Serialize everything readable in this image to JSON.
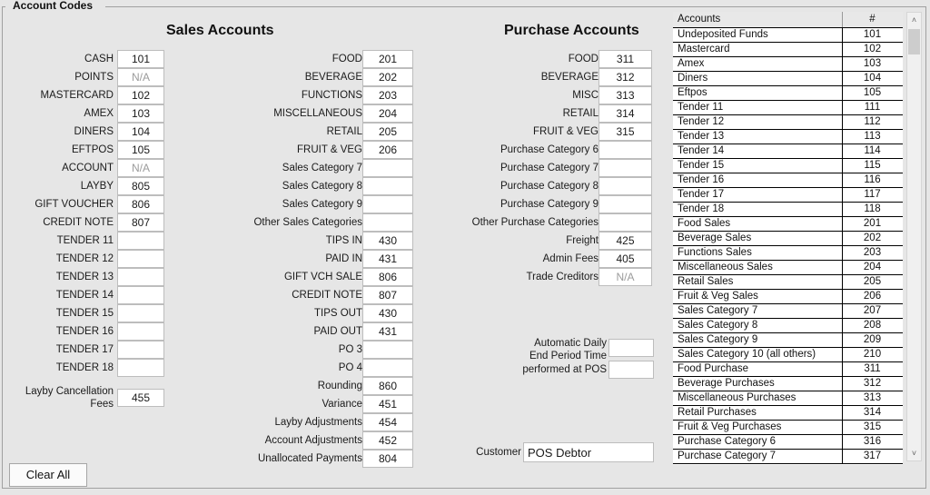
{
  "groupbox": {
    "title": "Account Codes"
  },
  "columns": {
    "sales": {
      "title": "Sales Accounts"
    },
    "purchase": {
      "title": "Purchase Accounts"
    }
  },
  "buttons": {
    "clear_all": "Clear All"
  },
  "left_column": {
    "rows": [
      {
        "label": "CASH",
        "value": "101",
        "disabled": false
      },
      {
        "label": "POINTS",
        "value": "N/A",
        "disabled": true
      },
      {
        "label": "MASTERCARD",
        "value": "102",
        "disabled": false
      },
      {
        "label": "AMEX",
        "value": "103",
        "disabled": false
      },
      {
        "label": "DINERS",
        "value": "104",
        "disabled": false
      },
      {
        "label": "EFTPOS",
        "value": "105",
        "disabled": false
      },
      {
        "label": "ACCOUNT",
        "value": "N/A",
        "disabled": true
      },
      {
        "label": "LAYBY",
        "value": "805",
        "disabled": false
      },
      {
        "label": "GIFT VOUCHER",
        "value": "806",
        "disabled": false
      },
      {
        "label": "CREDIT NOTE",
        "value": "807",
        "disabled": false
      },
      {
        "label": "TENDER 11",
        "value": "",
        "disabled": false
      },
      {
        "label": "TENDER 12",
        "value": "",
        "disabled": false
      },
      {
        "label": "TENDER 13",
        "value": "",
        "disabled": false
      },
      {
        "label": "TENDER 14",
        "value": "",
        "disabled": false
      },
      {
        "label": "TENDER 15",
        "value": "",
        "disabled": false
      },
      {
        "label": "TENDER 16",
        "value": "",
        "disabled": false
      },
      {
        "label": "TENDER 17",
        "value": "",
        "disabled": false
      },
      {
        "label": "TENDER 18",
        "value": "",
        "disabled": false
      }
    ],
    "layby_fee": {
      "label_line1": "Layby Cancellation",
      "label_line2": "Fees",
      "value": "455"
    }
  },
  "middle_column": {
    "rows": [
      {
        "label": "FOOD",
        "value": "201"
      },
      {
        "label": "BEVERAGE",
        "value": "202"
      },
      {
        "label": "FUNCTIONS",
        "value": "203"
      },
      {
        "label": "MISCELLANEOUS",
        "value": "204"
      },
      {
        "label": "RETAIL",
        "value": "205"
      },
      {
        "label": "FRUIT & VEG",
        "value": "206"
      },
      {
        "label": "Sales Category 7",
        "value": ""
      },
      {
        "label": "Sales Category 8",
        "value": ""
      },
      {
        "label": "Sales Category 9",
        "value": ""
      },
      {
        "label": "Other Sales Categories",
        "value": ""
      },
      {
        "label": "TIPS IN",
        "value": "430"
      },
      {
        "label": "PAID IN",
        "value": "431"
      },
      {
        "label": "GIFT VCH SALE",
        "value": "806"
      },
      {
        "label": "CREDIT NOTE",
        "value": "807"
      },
      {
        "label": "TIPS OUT",
        "value": "430"
      },
      {
        "label": "PAID OUT",
        "value": "431"
      },
      {
        "label": "PO 3",
        "value": ""
      },
      {
        "label": "PO 4",
        "value": ""
      },
      {
        "label": "Rounding",
        "value": "860"
      },
      {
        "label": "Variance",
        "value": "451"
      },
      {
        "label": "Layby Adjustments",
        "value": "454"
      },
      {
        "label": "Account Adjustments",
        "value": "452"
      },
      {
        "label": "Unallocated Payments",
        "value": "804"
      }
    ]
  },
  "right_column": {
    "rows": [
      {
        "label": "FOOD",
        "value": "311",
        "disabled": false
      },
      {
        "label": "BEVERAGE",
        "value": "312",
        "disabled": false
      },
      {
        "label": "MISC",
        "value": "313",
        "disabled": false
      },
      {
        "label": "RETAIL",
        "value": "314",
        "disabled": false
      },
      {
        "label": "FRUIT & VEG",
        "value": "315",
        "disabled": false
      },
      {
        "label": "Purchase Category 6",
        "value": "",
        "disabled": false
      },
      {
        "label": "Purchase Category 7",
        "value": "",
        "disabled": false
      },
      {
        "label": "Purchase Category 8",
        "value": "",
        "disabled": false
      },
      {
        "label": "Purchase Category 9",
        "value": "",
        "disabled": false
      },
      {
        "label": "Other Purchase Categories",
        "value": "",
        "disabled": false
      },
      {
        "label": "Freight",
        "value": "425",
        "disabled": false
      },
      {
        "label": "Admin Fees",
        "value": "405",
        "disabled": false
      },
      {
        "label": "Trade Creditors",
        "value": "N/A",
        "disabled": true
      }
    ],
    "end_period": {
      "label_line1": "Automatic Daily",
      "label_line2": "End Period Time",
      "label_line3": "performed at POS",
      "time_value": "",
      "pos_value": ""
    },
    "customer": {
      "label": "Customer",
      "value": "POS Debtor"
    }
  },
  "accounts_table": {
    "headers": {
      "name": "Accounts",
      "number": "#"
    },
    "rows": [
      {
        "name": "Undeposited Funds",
        "num": "101"
      },
      {
        "name": "Mastercard",
        "num": "102"
      },
      {
        "name": "Amex",
        "num": "103"
      },
      {
        "name": "Diners",
        "num": "104"
      },
      {
        "name": "Eftpos",
        "num": "105"
      },
      {
        "name": "Tender 11",
        "num": "111"
      },
      {
        "name": "Tender 12",
        "num": "112"
      },
      {
        "name": "Tender 13",
        "num": "113"
      },
      {
        "name": "Tender 14",
        "num": "114"
      },
      {
        "name": "Tender 15",
        "num": "115"
      },
      {
        "name": "Tender 16",
        "num": "116"
      },
      {
        "name": "Tender 17",
        "num": "117"
      },
      {
        "name": "Tender 18",
        "num": "118"
      },
      {
        "name": "Food Sales",
        "num": "201"
      },
      {
        "name": "Beverage Sales",
        "num": "202"
      },
      {
        "name": "Functions Sales",
        "num": "203"
      },
      {
        "name": "Miscellaneous Sales",
        "num": "204"
      },
      {
        "name": "Retail Sales",
        "num": "205"
      },
      {
        "name": "Fruit & Veg Sales",
        "num": "206"
      },
      {
        "name": "Sales Category 7",
        "num": "207"
      },
      {
        "name": "Sales Category 8",
        "num": "208"
      },
      {
        "name": "Sales Category 9",
        "num": "209"
      },
      {
        "name": "Sales Category 10 (all others)",
        "num": "210"
      },
      {
        "name": "Food Purchase",
        "num": "311"
      },
      {
        "name": "Beverage Purchases",
        "num": "312"
      },
      {
        "name": "Miscellaneous Purchases",
        "num": "313"
      },
      {
        "name": "Retail Purchases",
        "num": "314"
      },
      {
        "name": "Fruit & Veg Purchases",
        "num": "315"
      },
      {
        "name": "Purchase Category 6",
        "num": "316"
      },
      {
        "name": "Purchase Category 7",
        "num": "317"
      }
    ]
  },
  "scrollbar": {
    "up_icon": "˄",
    "down_icon": "˅"
  },
  "colors": {
    "window_bg": "#e6e6e6",
    "field_bg": "#ffffff",
    "field_border": "#bdbdbd",
    "disabled_text": "#9b9b9b",
    "text": "#1a1a1a",
    "table_grid": "#000000",
    "scroll_thumb": "#cdcdcd"
  }
}
